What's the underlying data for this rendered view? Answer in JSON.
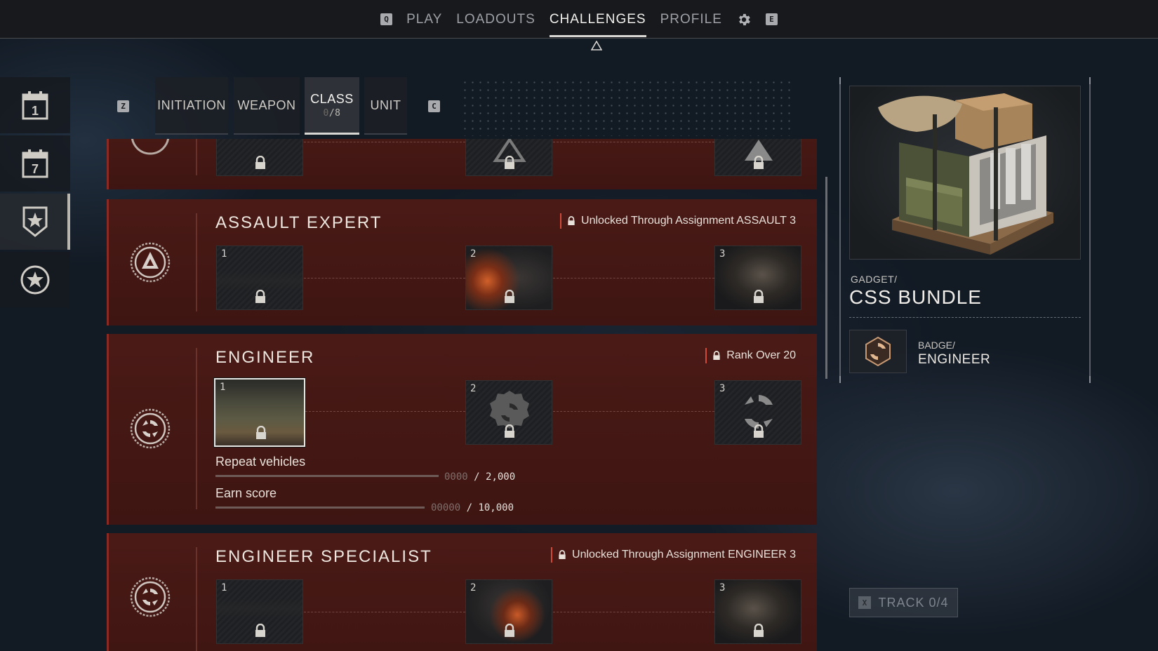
{
  "nav": {
    "left_key": "Q",
    "items": [
      "PLAY",
      "LOADOUTS",
      "CHALLENGES",
      "PROFILE"
    ],
    "active": "CHALLENGES",
    "right_key": "E"
  },
  "rail": {
    "items": [
      {
        "icon": "daily-calendar-icon",
        "label": "1"
      },
      {
        "icon": "weekly-calendar-icon",
        "label": "7"
      },
      {
        "icon": "shield-star-icon",
        "label": ""
      },
      {
        "icon": "star-circle-icon",
        "label": ""
      }
    ],
    "active_index": 2
  },
  "subtabs": {
    "left_key": "Z",
    "right_key": "C",
    "items": [
      {
        "label": "INITIATION",
        "count": ""
      },
      {
        "label": "WEAPON",
        "count": ""
      },
      {
        "label": "CLASS",
        "count_done": "0",
        "count_total": "/8"
      },
      {
        "label": "UNIT",
        "count": ""
      }
    ],
    "active": "CLASS"
  },
  "challenges": [
    {
      "title": "",
      "emblem": "assault-emblem-icon",
      "tiles": [
        {
          "num": ""
        },
        {
          "num": ""
        },
        {
          "num": ""
        }
      ]
    },
    {
      "title": "ASSAULT EXPERT",
      "emblem": "assault-emblem-icon",
      "requirement": "Unlocked Through Assignment ASSAULT 3",
      "tiles": [
        {
          "num": "1"
        },
        {
          "num": "2"
        },
        {
          "num": "3"
        }
      ]
    },
    {
      "title": "ENGINEER",
      "emblem": "engineer-emblem-icon",
      "requirement": "Rank Over 20",
      "tiles": [
        {
          "num": "1"
        },
        {
          "num": "2"
        },
        {
          "num": "3"
        }
      ],
      "tasks": [
        {
          "label": "Repeat vehicles",
          "progress_dim": "0000",
          "goal": "/ 2,000",
          "fraction": 0
        },
        {
          "label": "Earn score",
          "progress_dim": "00000",
          "goal": "/ 10,000",
          "fraction": 0
        }
      ]
    },
    {
      "title": "ENGINEER SPECIALIST",
      "emblem": "engineer-emblem-icon",
      "requirement": "Unlocked Through Assignment ENGINEER 3",
      "tiles": [
        {
          "num": "1"
        },
        {
          "num": "2"
        },
        {
          "num": "3"
        }
      ]
    }
  ],
  "detail": {
    "category": "GADGET/",
    "name": "CSS BUNDLE",
    "badge_category": "BADGE/",
    "badge_name": "ENGINEER"
  },
  "track": {
    "key": "X",
    "label": "TRACK 0/4"
  },
  "colors": {
    "card": "#4a1a16",
    "accent_red": "#d04a3a",
    "topbar": "#17191c"
  }
}
